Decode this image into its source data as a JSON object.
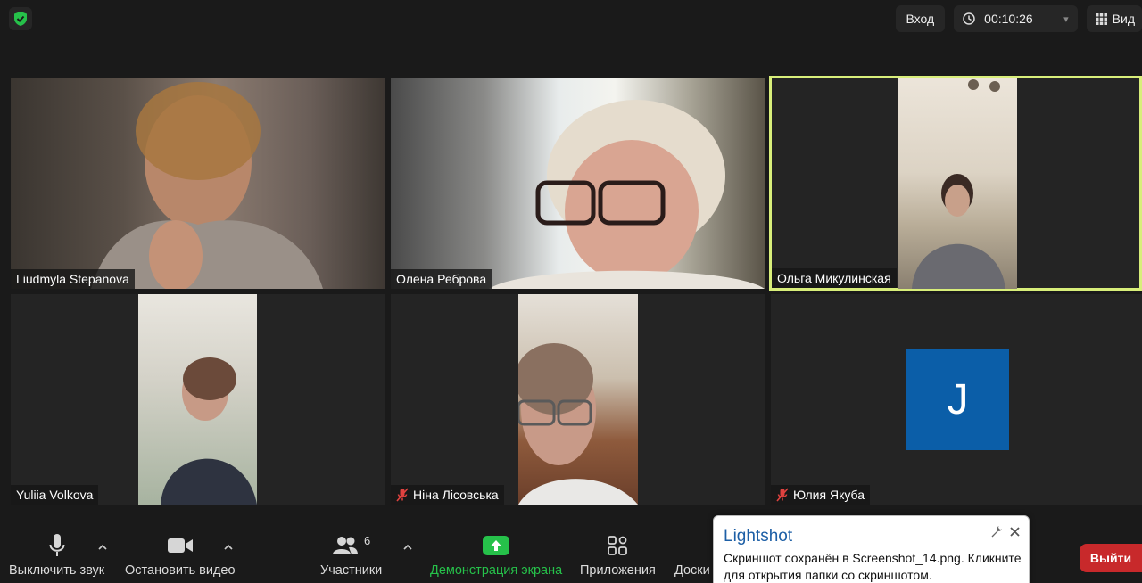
{
  "topbar": {
    "login_label": "Вход",
    "timer": "00:10:26",
    "view_label": "Вид"
  },
  "participants": [
    {
      "name": "Liudmyla Stepanova",
      "muted": false,
      "active": false
    },
    {
      "name": "Олена Реброва",
      "muted": false,
      "active": false
    },
    {
      "name": "Ольга Микулинская",
      "muted": false,
      "active": true
    },
    {
      "name": "Yuliia Volkova",
      "muted": false,
      "active": false
    },
    {
      "name": "Ніна Лісовська",
      "muted": true,
      "active": false
    },
    {
      "name": "Юлия Якуба",
      "muted": true,
      "active": false,
      "avatar_letter": "J"
    }
  ],
  "toolbar": {
    "mute_label": "Выключить звук",
    "video_label": "Остановить видео",
    "participants_label": "Участники",
    "participants_count": "6",
    "share_label": "Демонстрация экрана",
    "apps_label": "Приложения",
    "whiteboard_label": "Доски",
    "leave_label": "Выйти"
  },
  "toast": {
    "title": "Lightshot",
    "message": "Скриншот сохранён в Screenshot_14.png. Кликните для открытия папки со скриншотом."
  },
  "colors": {
    "accent_green": "#26c14a",
    "active_border": "#d8ee7a",
    "leave_red": "#c8292b",
    "avatar_blue": "#0b5ea8",
    "toast_title": "#1d5fa6"
  }
}
